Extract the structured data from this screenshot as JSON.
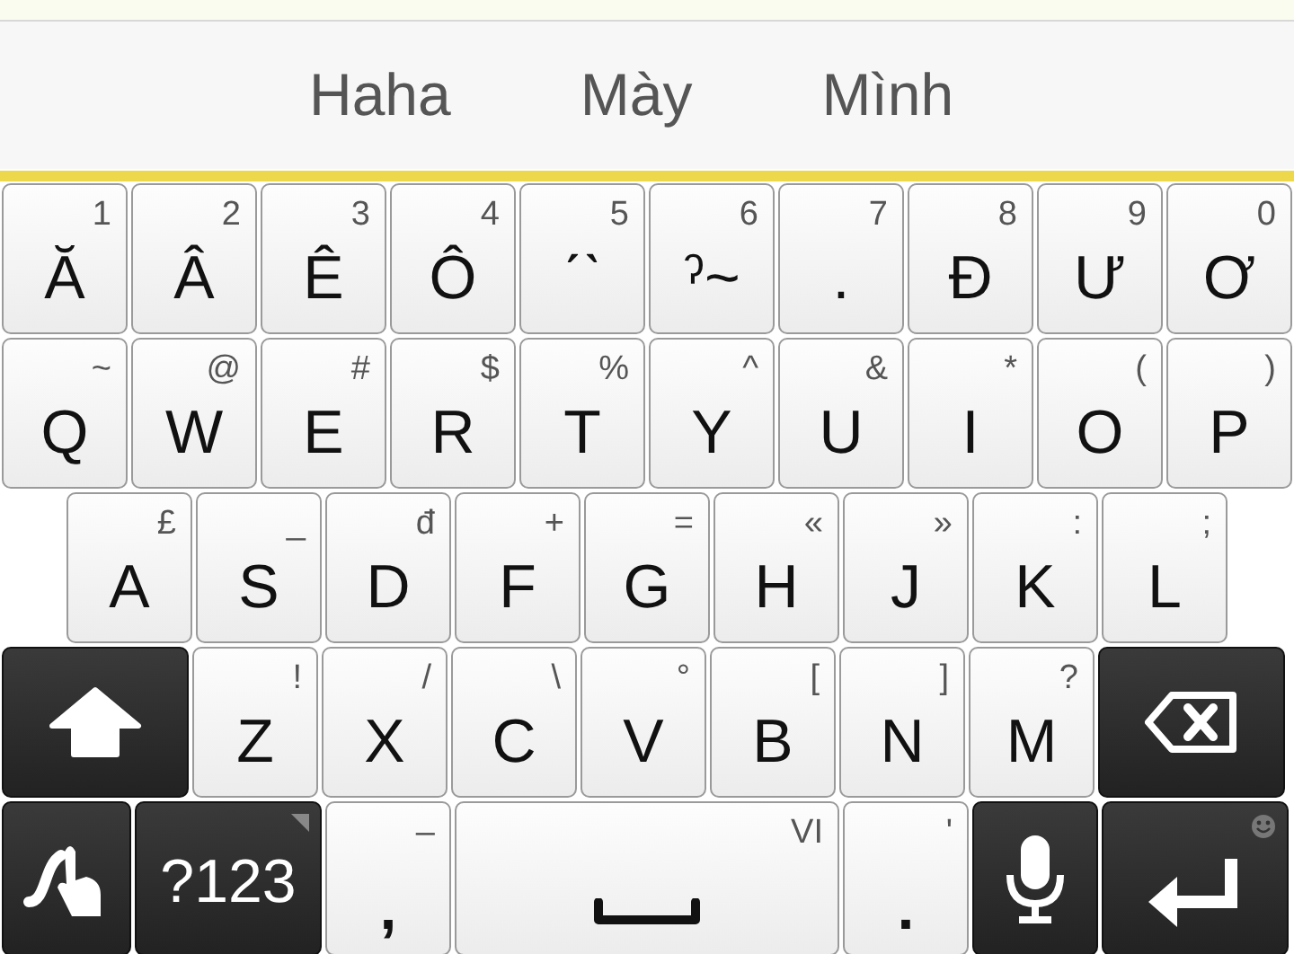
{
  "suggestions": [
    {
      "label": "Haha"
    },
    {
      "label": "Mày"
    },
    {
      "label": "Mình"
    }
  ],
  "rows": [
    [
      {
        "kind": "letter",
        "main": "Ă",
        "hint": "1"
      },
      {
        "kind": "letter",
        "main": "Â",
        "hint": "2"
      },
      {
        "kind": "letter",
        "main": "Ê",
        "hint": "3"
      },
      {
        "kind": "letter",
        "main": "Ô",
        "hint": "4"
      },
      {
        "kind": "letter",
        "main": "ˊˋ",
        "hint": "5"
      },
      {
        "kind": "letter",
        "main": "ˀ~",
        "hint": "6"
      },
      {
        "kind": "letter",
        "main": ".",
        "hint": "7"
      },
      {
        "kind": "letter",
        "main": "Đ",
        "hint": "8"
      },
      {
        "kind": "letter",
        "main": "Ư",
        "hint": "9"
      },
      {
        "kind": "letter",
        "main": "Ơ",
        "hint": "0"
      }
    ],
    [
      {
        "kind": "letter",
        "main": "Q",
        "hint": "~"
      },
      {
        "kind": "letter",
        "main": "W",
        "hint": "@"
      },
      {
        "kind": "letter",
        "main": "E",
        "hint": "#"
      },
      {
        "kind": "letter",
        "main": "R",
        "hint": "$"
      },
      {
        "kind": "letter",
        "main": "T",
        "hint": "%"
      },
      {
        "kind": "letter",
        "main": "Y",
        "hint": "^"
      },
      {
        "kind": "letter",
        "main": "U",
        "hint": "&"
      },
      {
        "kind": "letter",
        "main": "I",
        "hint": "*"
      },
      {
        "kind": "letter",
        "main": "O",
        "hint": "("
      },
      {
        "kind": "letter",
        "main": "P",
        "hint": ")"
      }
    ],
    [
      {
        "kind": "letter",
        "main": "A",
        "hint": "£"
      },
      {
        "kind": "letter",
        "main": "S",
        "hint": "_"
      },
      {
        "kind": "letter",
        "main": "D",
        "hint": "đ"
      },
      {
        "kind": "letter",
        "main": "F",
        "hint": "+"
      },
      {
        "kind": "letter",
        "main": "G",
        "hint": "="
      },
      {
        "kind": "letter",
        "main": "H",
        "hint": "«"
      },
      {
        "kind": "letter",
        "main": "J",
        "hint": "»"
      },
      {
        "kind": "letter",
        "main": "K",
        "hint": ":"
      },
      {
        "kind": "letter",
        "main": "L",
        "hint": ";"
      }
    ],
    [
      {
        "kind": "shift"
      },
      {
        "kind": "letter",
        "main": "Z",
        "hint": "!"
      },
      {
        "kind": "letter",
        "main": "X",
        "hint": "/"
      },
      {
        "kind": "letter",
        "main": "C",
        "hint": "\\"
      },
      {
        "kind": "letter",
        "main": "V",
        "hint": "°"
      },
      {
        "kind": "letter",
        "main": "B",
        "hint": "["
      },
      {
        "kind": "letter",
        "main": "N",
        "hint": "]"
      },
      {
        "kind": "letter",
        "main": "M",
        "hint": "?"
      },
      {
        "kind": "backspace"
      }
    ],
    [
      {
        "kind": "swype"
      },
      {
        "kind": "symbols",
        "main": "?123"
      },
      {
        "kind": "letter",
        "main": ",",
        "hint": "–"
      },
      {
        "kind": "space",
        "hint": "VI"
      },
      {
        "kind": "letter",
        "main": ".",
        "hint": "'"
      },
      {
        "kind": "mic"
      },
      {
        "kind": "enter"
      }
    ]
  ]
}
